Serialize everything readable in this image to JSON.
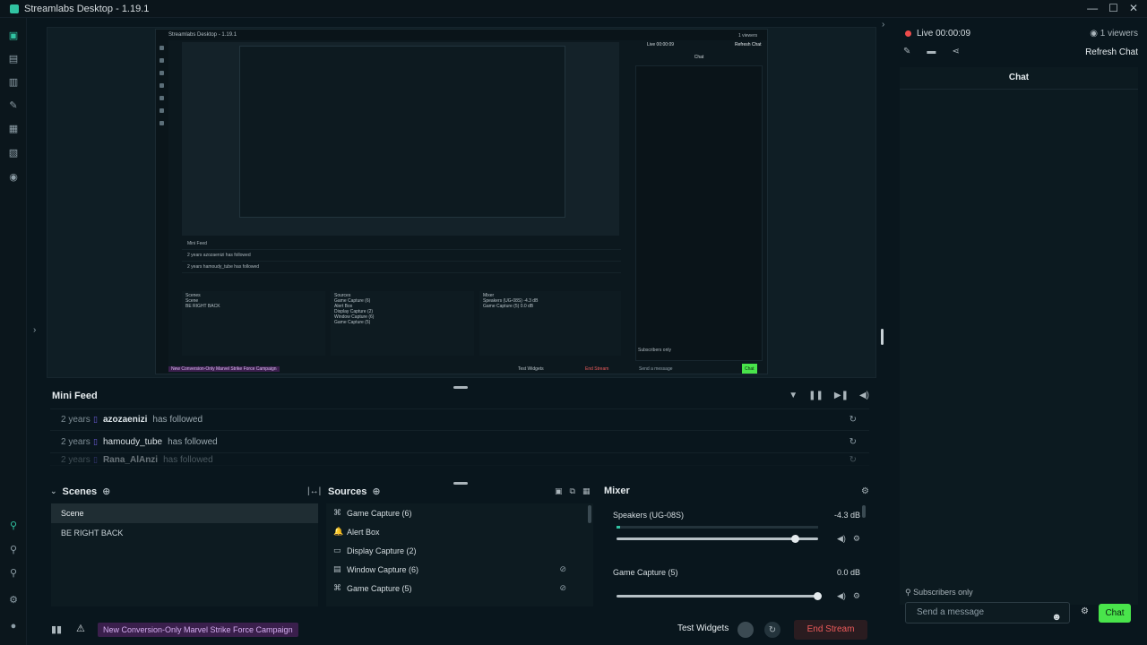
{
  "window": {
    "title": "Streamlabs Desktop - 1.19.1"
  },
  "nested_preview": {
    "title": "Streamlabs Desktop - 1.19.1",
    "chat_title": "Chat",
    "minifeed_title": "Mini Feed",
    "rows": [
      "2 years  azozaenizi has followed",
      "2 years  hamoudy_tube has followed"
    ],
    "scenes_label": "Scenes",
    "sources_label": "Sources",
    "mixer_label": "Mixer",
    "scene1": "Scene",
    "scene2": "BE RIGHT BACK",
    "src1": "Game Capture (6)",
    "src2": "Alert Box",
    "src3": "Display Capture (2)",
    "src4": "Window Capture (6)",
    "src5": "Game Capture (5)",
    "mix1": "Speakers (UG-08S)",
    "mix1_db": "-4.3 dB",
    "mix2": "Game Capture (5)",
    "mix2_db": "0.0 dB",
    "badge": "New Conversion-Only Marvel Strike Force Campaign",
    "test_widgets": "Test Widgets",
    "end_stream": "End Stream",
    "send_placeholder": "Send a message",
    "chat_btn": "Chat",
    "subs": "Subscribers only",
    "refresh": "Refresh Chat",
    "live": "Live 00:00:09",
    "viewers": "1 viewers"
  },
  "minifeed": {
    "title": "Mini Feed",
    "rows": [
      {
        "age": "2 years",
        "name": "azozaenizi",
        "action": "has followed"
      },
      {
        "age": "2 years",
        "name": "hamoudy_tube",
        "action": "has followed"
      },
      {
        "age": "2 years",
        "name": "Rana_AlAnzi",
        "action": "has followed"
      }
    ]
  },
  "scenes": {
    "title": "Scenes",
    "items": [
      "Scene",
      "BE RIGHT BACK"
    ],
    "selected": "Scene"
  },
  "sources": {
    "title": "Sources",
    "items": [
      {
        "icon": "gamepad-icon",
        "glyph": "⌘",
        "label": "Game Capture (6)",
        "locked": false
      },
      {
        "icon": "bell-icon",
        "glyph": "🔔",
        "label": "Alert Box",
        "locked": false
      },
      {
        "icon": "monitor-icon",
        "glyph": "▭",
        "label": "Display Capture (2)",
        "locked": false
      },
      {
        "icon": "window-icon",
        "glyph": "▤",
        "label": "Window Capture (6)",
        "locked": true
      },
      {
        "icon": "gamepad-icon",
        "glyph": "⌘",
        "label": "Game Capture (5)",
        "locked": true
      }
    ]
  },
  "mixer": {
    "title": "Mixer",
    "channels": [
      {
        "name": "Speakers (UG-08S)",
        "db": "-4.3 dB",
        "volume": 0.89
      },
      {
        "name": "Game Capture (5)",
        "db": "0.0 dB",
        "volume": 1.0
      }
    ]
  },
  "footer": {
    "badge": "New Conversion-Only Marvel Strike Force Campaign",
    "test_widgets": "Test Widgets",
    "end_stream": "End Stream"
  },
  "right": {
    "live": "Live 00:00:09",
    "viewers": "1 viewers",
    "refresh_chat": "Refresh Chat",
    "chat_title": "Chat",
    "subscribers_only": "Subscribers only",
    "send_placeholder": "Send a message",
    "chat_button": "Chat"
  },
  "colors": {
    "accent": "#31c3a2",
    "live": "#ee4b4b",
    "chat_button": "#49e44b",
    "end_stream": "#ee5b5b"
  }
}
